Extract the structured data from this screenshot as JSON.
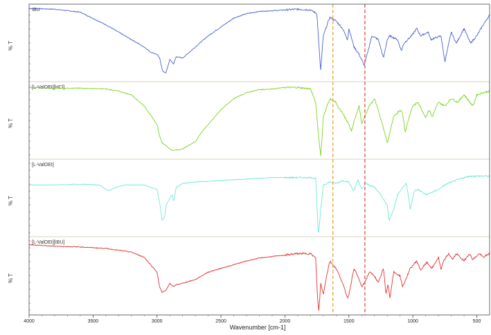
{
  "chart_data": {
    "type": "line",
    "xlabel": "Wavenumber [cm-1]",
    "xlim": [
      4000,
      400
    ],
    "x_ticks": [
      "4000",
      "3500",
      "3000",
      "2500",
      "2000",
      "1500",
      "1000",
      "500"
    ],
    "panel_ylabel": "% T",
    "marker_lines": [
      {
        "x": 1625,
        "color": "#e8a020"
      },
      {
        "x": 1375,
        "color": "#e04030"
      }
    ],
    "series": [
      {
        "name": "IBU",
        "color": "#4a5fd0",
        "x": [
          4000,
          3800,
          3600,
          3400,
          3200,
          3100,
          3050,
          3000,
          2980,
          2955,
          2930,
          2900,
          2870,
          2850,
          2800,
          2700,
          2600,
          2500,
          2400,
          2300,
          2200,
          2100,
          2000,
          1900,
          1800,
          1750,
          1721,
          1700,
          1650,
          1600,
          1550,
          1510,
          1500,
          1460,
          1420,
          1380,
          1320,
          1270,
          1230,
          1200,
          1180,
          1120,
          1090,
          1070,
          1010,
          970,
          940,
          880,
          860,
          780,
          750,
          700,
          660,
          600,
          550,
          500,
          450,
          400
        ],
        "values": [
          97,
          96,
          92,
          75,
          55,
          45,
          38,
          35,
          30,
          12,
          10,
          28,
          22,
          32,
          30,
          45,
          60,
          72,
          84,
          90,
          93,
          94,
          95,
          96,
          95,
          90,
          12,
          60,
          85,
          80,
          70,
          55,
          70,
          45,
          35,
          20,
          60,
          55,
          30,
          55,
          60,
          55,
          40,
          50,
          60,
          70,
          60,
          65,
          55,
          60,
          25,
          65,
          50,
          70,
          50,
          60,
          75,
          88
        ],
        "noise": 1.5
      },
      {
        "name": "[L-ValOEt][HCl]",
        "color": "#7ed321",
        "x": [
          4000,
          3800,
          3600,
          3400,
          3300,
          3200,
          3100,
          3000,
          2980,
          2960,
          2940,
          2900,
          2880,
          2870,
          2800,
          2700,
          2650,
          2600,
          2500,
          2400,
          2300,
          2200,
          2100,
          2000,
          1900,
          1800,
          1760,
          1740,
          1720,
          1700,
          1650,
          1600,
          1590,
          1550,
          1500,
          1480,
          1460,
          1420,
          1400,
          1380,
          1340,
          1300,
          1280,
          1230,
          1200,
          1150,
          1100,
          1080,
          1060,
          1030,
          1000,
          960,
          900,
          870,
          850,
          800,
          750,
          700,
          650,
          600,
          530,
          500,
          450,
          400
        ],
        "values": [
          95,
          94,
          94,
          93,
          90,
          85,
          70,
          45,
          30,
          20,
          18,
          12,
          10,
          10,
          12,
          22,
          35,
          45,
          65,
          80,
          88,
          92,
          93,
          95,
          95,
          93,
          75,
          35,
          2,
          55,
          80,
          75,
          70,
          60,
          45,
          35,
          50,
          70,
          45,
          55,
          70,
          80,
          70,
          40,
          20,
          55,
          65,
          60,
          35,
          55,
          70,
          75,
          55,
          65,
          55,
          75,
          70,
          80,
          75,
          85,
          70,
          85,
          88,
          90
        ],
        "noise": 1.5
      },
      {
        "name": "[L-ValOEt]",
        "color": "#6ee8d8",
        "x": [
          4000,
          3800,
          3600,
          3450,
          3380,
          3320,
          3250,
          3200,
          3100,
          3000,
          2980,
          2960,
          2940,
          2930,
          2900,
          2880,
          2870,
          2850,
          2800,
          2700,
          2500,
          2300,
          2100,
          2000,
          1900,
          1800,
          1760,
          1740,
          1735,
          1720,
          1700,
          1650,
          1600,
          1550,
          1500,
          1470,
          1460,
          1430,
          1400,
          1370,
          1300,
          1250,
          1200,
          1185,
          1150,
          1120,
          1100,
          1050,
          1020,
          990,
          960,
          900,
          850,
          800,
          750,
          700,
          650,
          600,
          550,
          500,
          450,
          400
        ],
        "values": [
          68,
          68,
          69,
          68,
          60,
          65,
          68,
          68,
          68,
          62,
          45,
          20,
          25,
          40,
          50,
          55,
          45,
          65,
          70,
          72,
          74,
          76,
          78,
          78,
          78,
          78,
          77,
          5,
          4,
          35,
          68,
          72,
          70,
          74,
          72,
          62,
          60,
          75,
          62,
          70,
          65,
          55,
          40,
          20,
          35,
          55,
          60,
          70,
          35,
          60,
          62,
          55,
          58,
          62,
          68,
          72,
          75,
          78,
          80,
          80,
          80,
          80
        ],
        "noise": 1.2
      },
      {
        "name": "[L-ValOEt][IBU]",
        "color": "#e03030",
        "x": [
          4000,
          3800,
          3600,
          3400,
          3200,
          3100,
          3000,
          2980,
          2960,
          2930,
          2900,
          2870,
          2850,
          2800,
          2700,
          2600,
          2500,
          2400,
          2300,
          2200,
          2100,
          2000,
          1900,
          1800,
          1760,
          1745,
          1735,
          1720,
          1700,
          1680,
          1650,
          1600,
          1560,
          1510,
          1500,
          1460,
          1420,
          1400,
          1380,
          1340,
          1300,
          1270,
          1230,
          1210,
          1195,
          1180,
          1150,
          1100,
          1080,
          1020,
          970,
          940,
          890,
          850,
          800,
          780,
          760,
          720,
          690,
          660,
          600,
          560,
          530,
          480,
          450,
          400
        ],
        "values": [
          92,
          90,
          89,
          87,
          82,
          75,
          55,
          35,
          28,
          30,
          40,
          35,
          38,
          40,
          45,
          55,
          60,
          65,
          70,
          74,
          76,
          78,
          80,
          80,
          74,
          20,
          1,
          40,
          25,
          45,
          70,
          60,
          45,
          20,
          25,
          60,
          45,
          35,
          40,
          55,
          50,
          40,
          60,
          25,
          40,
          20,
          55,
          50,
          35,
          60,
          70,
          58,
          68,
          60,
          75,
          58,
          70,
          80,
          72,
          80,
          70,
          80,
          72,
          80,
          75,
          80
        ],
        "noise": 1.5
      }
    ]
  }
}
